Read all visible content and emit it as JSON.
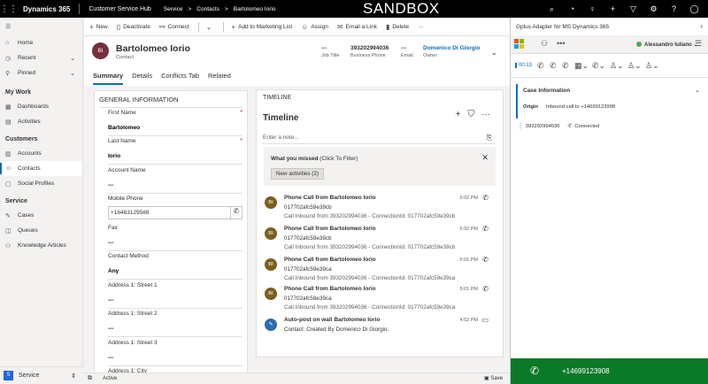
{
  "topbar": {
    "brand": "Dynamics 365",
    "app_name": "Customer Service Hub",
    "breadcrumbs": [
      "Service",
      ">",
      "Contacts",
      ">",
      "Bartolomeo Iorio"
    ],
    "environment": "SANDBOX"
  },
  "sidebar": {
    "items_top": [
      {
        "label": "Home",
        "icon": "home-icon"
      },
      {
        "label": "Recent",
        "icon": "clock-icon"
      },
      {
        "label": "Pinned",
        "icon": "pin-icon"
      }
    ],
    "groups": [
      {
        "label": "My Work",
        "items": [
          {
            "label": "Dashboards",
            "icon": "dashboard-icon"
          },
          {
            "label": "Activities",
            "icon": "calendar-icon"
          }
        ]
      },
      {
        "label": "Customers",
        "items": [
          {
            "label": "Accounts",
            "icon": "building-icon"
          },
          {
            "label": "Contacts",
            "icon": "person-icon"
          },
          {
            "label": "Social Profiles",
            "icon": "social-icon"
          }
        ]
      },
      {
        "label": "Service",
        "items": [
          {
            "label": "Cases",
            "icon": "wrench-icon"
          },
          {
            "label": "Queues",
            "icon": "queue-icon"
          },
          {
            "label": "Knowledge Articles",
            "icon": "people-icon"
          }
        ]
      }
    ],
    "area": {
      "badge": "S",
      "label": "Service"
    }
  },
  "commands": [
    "New",
    "Deactivate",
    "Connect",
    "Add to Marketing List",
    "Assign",
    "Email a Link",
    "Delete",
    "···"
  ],
  "record": {
    "initials": "BI",
    "name": "Bartolomeo Iorio",
    "type": "Contact",
    "fields": [
      {
        "value": "---",
        "label": "Job Title"
      },
      {
        "value": "393202994036",
        "label": "Business Phone"
      },
      {
        "value": "---",
        "label": "Email"
      },
      {
        "value": "Domenico Di Giorgio",
        "label": "Owner"
      }
    ],
    "tabs": [
      "Summary",
      "Details",
      "Conflicts Tab",
      "Related"
    ]
  },
  "general": {
    "title": "GENERAL INFORMATION",
    "first_name_label": "First Name",
    "first_name": "Bartolomeo",
    "last_name_label": "Last Name",
    "last_name": "Iorio",
    "account_label": "Account Name",
    "account": "---",
    "mobile_label": "Mobile Phone",
    "mobile": "+16463129568",
    "fax_label": "Fax",
    "fax": "---",
    "method_label": "Contact Method",
    "method": "Any",
    "street1_label": "Address 1: Street 1",
    "street1": "---",
    "street2_label": "Address 1: Street 2",
    "street2": "---",
    "street3_label": "Address 1: Street 3",
    "street3": "---",
    "city_label": "Address 1: City"
  },
  "timeline": {
    "caption": "TIMELINE",
    "heading": "Timeline",
    "note_placeholder": "Enter a note...",
    "missed_title": "What you missed",
    "missed_hint": "(Click To Filter)",
    "new_activities": "New activities (2)",
    "entries": [
      {
        "initials": "BI",
        "title": "Phone Call from Bartolomeo Iorio",
        "line2": "017702afc59e39cb",
        "line3": "Call Inbound from 393202994036 - ConnectionId: 017702afc59e39cb",
        "time": "5:02 PM"
      },
      {
        "initials": "BI",
        "title": "Phone Call from Bartolomeo Iorio",
        "line2": "017702afc59e39cb",
        "line3": "Call Inbound from 393202994036 - ConnectionId: 017702afc59e39cb",
        "time": "5:02 PM"
      },
      {
        "initials": "BI",
        "title": "Phone Call from Bartolomeo Iorio",
        "line2": "017702afc59e39ca",
        "line3": "Call Inbound from 393202994036 - ConnectionId: 017702afc59e39ca",
        "time": "5:01 PM"
      },
      {
        "initials": "BI",
        "title": "Phone Call from Bartolomeo Iorio",
        "line2": "017702afc59e39ca",
        "line3": "Call Inbound from 393202994036 - ConnectionId: 017702afc59e39ca",
        "time": "5:01 PM"
      },
      {
        "initials": "",
        "title": "Auto-post on wall Bartolomeo Iorio",
        "line2": "Contact: Created By Domenico Di Giorgio.",
        "line3": "",
        "time": "4:52 PM"
      }
    ]
  },
  "status": {
    "state": "Active",
    "save": "Save"
  },
  "adapter": {
    "title": "Gplus Adapter for MS Dynamics 365",
    "user": "Alessandro Iuliano",
    "timer": "00:13",
    "case_title": "Case Information",
    "origin_label": "Origin",
    "origin_value": "Inbound call to +14699123908",
    "conn_number": "393202994036",
    "conn_status": "Connected",
    "call_number": "+14699123908"
  }
}
